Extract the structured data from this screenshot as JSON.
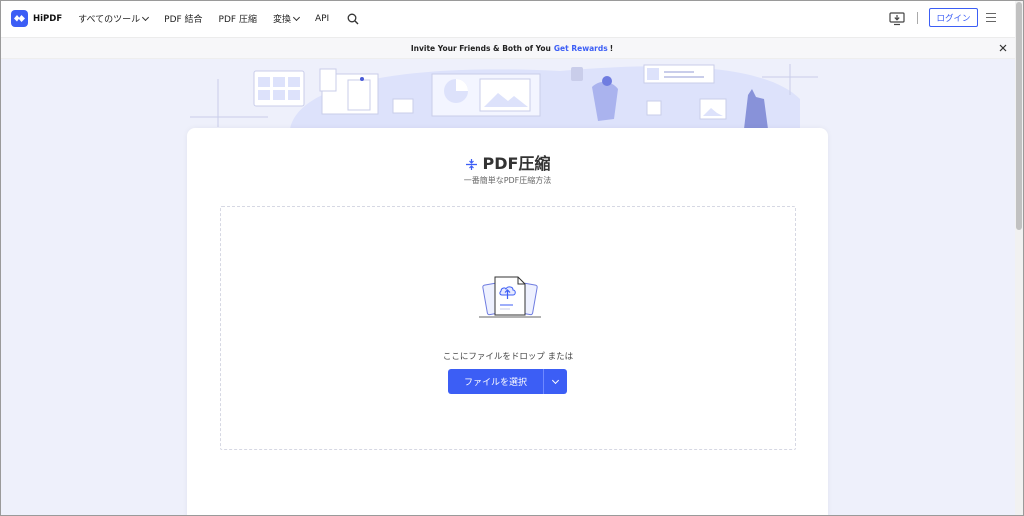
{
  "header": {
    "logo_text": "HiPDF",
    "nav": [
      {
        "label": "すべてのツール",
        "dropdown": true
      },
      {
        "label": "PDF 結合",
        "dropdown": false
      },
      {
        "label": "PDF 圧縮",
        "dropdown": false
      },
      {
        "label": "変換",
        "dropdown": true
      },
      {
        "label": "API",
        "dropdown": false
      }
    ],
    "login_label": "ログイン",
    "icons": [
      "search-icon",
      "download-app-icon",
      "menu-icon"
    ]
  },
  "banner": {
    "text": "Invite Your Friends & Both of You",
    "link": "Get Rewards",
    "suffix": "!"
  },
  "main": {
    "title": "PDF圧縮",
    "subtitle": "一番簡単なPDF圧縮方法",
    "drop_text": "ここにファイルをドロップ または",
    "choose_button": "ファイルを選択"
  },
  "colors": {
    "accent": "#3c5ef5",
    "page_background": "#eef0fb"
  }
}
